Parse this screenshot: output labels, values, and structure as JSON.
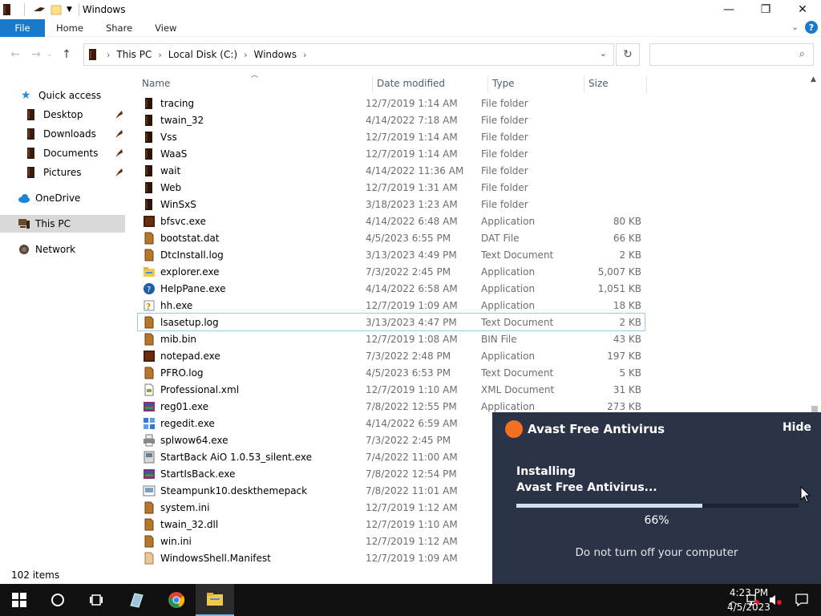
{
  "window": {
    "title": "Windows",
    "tabs": [
      {
        "label": "File"
      },
      {
        "label": "Home"
      },
      {
        "label": "Share"
      },
      {
        "label": "View"
      }
    ]
  },
  "address": {
    "crumbs": [
      "This PC",
      "Local Disk (C:)",
      "Windows"
    ],
    "search_placeholder": ""
  },
  "nav": {
    "items": [
      {
        "label": "Quick access"
      },
      {
        "label": "Desktop"
      },
      {
        "label": "Downloads"
      },
      {
        "label": "Documents"
      },
      {
        "label": "Pictures"
      },
      {
        "label": "OneDrive"
      },
      {
        "label": "This PC"
      },
      {
        "label": "Network"
      }
    ]
  },
  "columns": {
    "name": "Name",
    "date": "Date modified",
    "type": "Type",
    "size": "Size"
  },
  "files": [
    {
      "name": "tracing",
      "date": "12/7/2019 1:14 AM",
      "type": "File folder",
      "size": "",
      "icon": "folder-icon"
    },
    {
      "name": "twain_32",
      "date": "4/14/2022 7:18 AM",
      "type": "File folder",
      "size": "",
      "icon": "folder-icon"
    },
    {
      "name": "Vss",
      "date": "12/7/2019 1:14 AM",
      "type": "File folder",
      "size": "",
      "icon": "folder-icon"
    },
    {
      "name": "WaaS",
      "date": "12/7/2019 1:14 AM",
      "type": "File folder",
      "size": "",
      "icon": "folder-icon"
    },
    {
      "name": "wait",
      "date": "4/14/2022 11:36 AM",
      "type": "File folder",
      "size": "",
      "icon": "folder-icon"
    },
    {
      "name": "Web",
      "date": "12/7/2019 1:31 AM",
      "type": "File folder",
      "size": "",
      "icon": "folder-icon"
    },
    {
      "name": "WinSxS",
      "date": "3/18/2023 1:23 AM",
      "type": "File folder",
      "size": "",
      "icon": "folder-icon"
    },
    {
      "name": "bfsvc.exe",
      "date": "4/14/2022 6:48 AM",
      "type": "Application",
      "size": "80 KB",
      "icon": "app-icon"
    },
    {
      "name": "bootstat.dat",
      "date": "4/5/2023 6:55 PM",
      "type": "DAT File",
      "size": "66 KB",
      "icon": "file-icon"
    },
    {
      "name": "DtcInstall.log",
      "date": "3/13/2023 4:49 PM",
      "type": "Text Document",
      "size": "2 KB",
      "icon": "file-icon"
    },
    {
      "name": "explorer.exe",
      "date": "7/3/2022 2:45 PM",
      "type": "Application",
      "size": "5,007 KB",
      "icon": "explorer-icon"
    },
    {
      "name": "HelpPane.exe",
      "date": "4/14/2022 6:58 AM",
      "type": "Application",
      "size": "1,051 KB",
      "icon": "help-icon"
    },
    {
      "name": "hh.exe",
      "date": "12/7/2019 1:09 AM",
      "type": "Application",
      "size": "18 KB",
      "icon": "hh-icon"
    },
    {
      "name": "lsasetup.log",
      "date": "3/13/2023 4:47 PM",
      "type": "Text Document",
      "size": "2 KB",
      "icon": "file-icon"
    },
    {
      "name": "mib.bin",
      "date": "12/7/2019 1:08 AM",
      "type": "BIN File",
      "size": "43 KB",
      "icon": "file-icon"
    },
    {
      "name": "notepad.exe",
      "date": "7/3/2022 2:48 PM",
      "type": "Application",
      "size": "197 KB",
      "icon": "app-icon"
    },
    {
      "name": "PFRO.log",
      "date": "4/5/2023 6:53 PM",
      "type": "Text Document",
      "size": "5 KB",
      "icon": "file-icon"
    },
    {
      "name": "Professional.xml",
      "date": "12/7/2019 1:10 AM",
      "type": "XML Document",
      "size": "31 KB",
      "icon": "xml-icon"
    },
    {
      "name": "reg01.exe",
      "date": "7/8/2022 12:55 PM",
      "type": "Application",
      "size": "273 KB",
      "icon": "archive-icon"
    },
    {
      "name": "regedit.exe",
      "date": "4/14/2022 6:59 AM",
      "type": "",
      "size": "",
      "icon": "regedit-icon"
    },
    {
      "name": "splwow64.exe",
      "date": "7/3/2022 2:45 PM",
      "type": "",
      "size": "",
      "icon": "printer-icon"
    },
    {
      "name": "StartBack AiO 1.0.53_silent.exe",
      "date": "7/4/2022 11:00 AM",
      "type": "",
      "size": "",
      "icon": "installer-icon"
    },
    {
      "name": "StartIsBack.exe",
      "date": "7/8/2022 12:54 PM",
      "type": "",
      "size": "",
      "icon": "archive-icon"
    },
    {
      "name": "Steampunk10.deskthemepack",
      "date": "7/8/2022 11:01 AM",
      "type": "",
      "size": "",
      "icon": "theme-icon"
    },
    {
      "name": "system.ini",
      "date": "12/7/2019 1:12 AM",
      "type": "",
      "size": "",
      "icon": "file-icon"
    },
    {
      "name": "twain_32.dll",
      "date": "12/7/2019 1:10 AM",
      "type": "",
      "size": "",
      "icon": "file-icon"
    },
    {
      "name": "win.ini",
      "date": "12/7/2019 1:12 AM",
      "type": "",
      "size": "",
      "icon": "file-icon"
    },
    {
      "name": "WindowsShell.Manifest",
      "date": "12/7/2019 1:09 AM",
      "type": "",
      "size": "",
      "icon": "manifest-icon"
    }
  ],
  "status": {
    "items": "102 items"
  },
  "avast": {
    "title": "Avast Free Antivirus",
    "hide": "Hide",
    "line1": "Installing",
    "line2": "Avast Free Antivirus...",
    "progress": 66,
    "progress_label": "66%",
    "message": "Do not turn off your computer"
  },
  "taskbar": {
    "time": "4:23 PM",
    "date": "4/5/2023"
  }
}
